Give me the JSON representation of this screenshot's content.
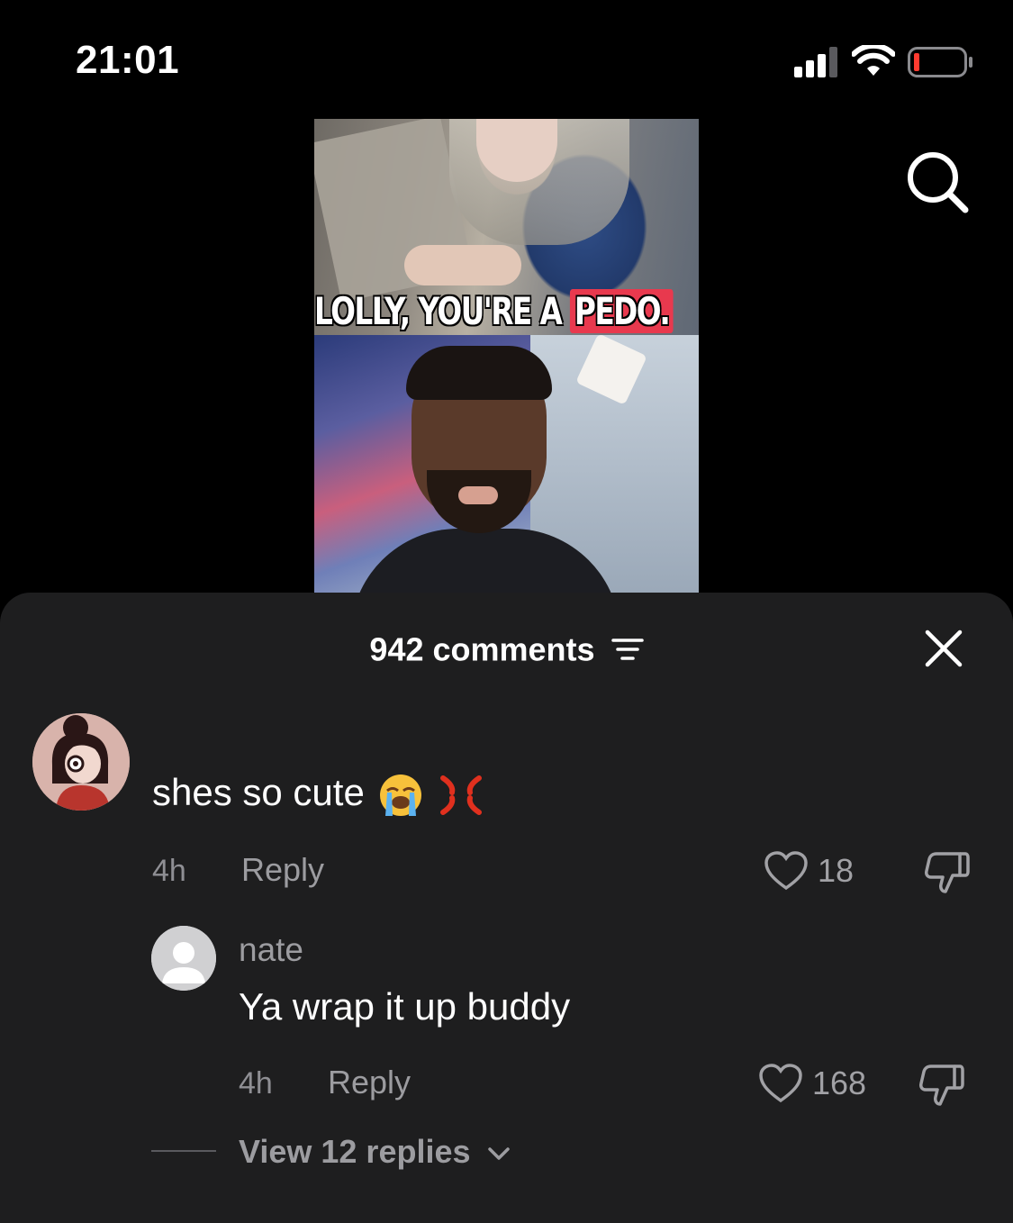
{
  "status_bar": {
    "time": "21:01",
    "icons": [
      "cellular-signal-icon",
      "wifi-icon",
      "battery-low-icon"
    ]
  },
  "video": {
    "caption_main": "LOLLY, YOU'RE A ",
    "caption_highlight": "PEDO.",
    "highlight_color": "#e8394e"
  },
  "header": {
    "search_icon": "search-icon"
  },
  "comments_sheet": {
    "count_label": "942 comments",
    "filter_icon": "filter-lines-icon",
    "close_icon": "close-icon",
    "background": "#1e1e1f"
  },
  "comment": {
    "text": "shes so cute",
    "emojis": [
      "loudly-crying-face-icon",
      "anger-symbol-icon"
    ],
    "time": "4h",
    "reply_label": "Reply",
    "likes": "18"
  },
  "reply": {
    "username": "nate",
    "text": "Ya wrap it up buddy",
    "time": "4h",
    "reply_label": "Reply",
    "likes": "168"
  },
  "view_replies": {
    "label": "View 12 replies"
  }
}
